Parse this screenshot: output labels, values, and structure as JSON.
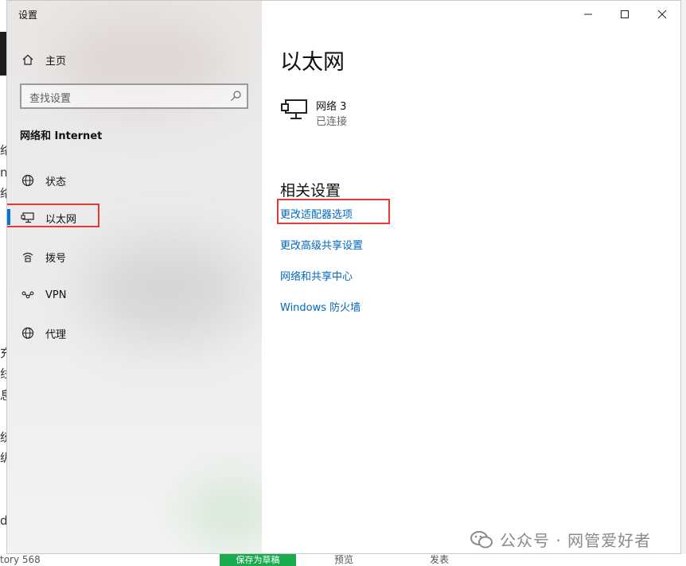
{
  "window": {
    "title": "设置"
  },
  "nav": {
    "home_label": "主页",
    "search_placeholder": "查找设置",
    "section_label": "网络和 Internet",
    "items": [
      {
        "label": "状态",
        "icon": "globe-status-icon"
      },
      {
        "label": "以太网",
        "icon": "ethernet-icon",
        "selected": true
      },
      {
        "label": "拨号",
        "icon": "dialup-icon"
      },
      {
        "label": "VPN",
        "icon": "vpn-icon"
      },
      {
        "label": "代理",
        "icon": "globe-proxy-icon"
      }
    ]
  },
  "content": {
    "page_title": "以太网",
    "network": {
      "name": "网络 3",
      "status": "已连接"
    },
    "related_title": "相关设置",
    "links": [
      "更改适配器选项",
      "更改高级共享设置",
      "网络和共享中心",
      "Windows 防火墙"
    ]
  },
  "watermark": "公众号 · 网管爱好者",
  "background": {
    "left_glyphs": [
      "络",
      "n",
      "络",
      "充",
      "线",
      "息",
      "统",
      "纵",
      "d"
    ],
    "bottom_texts": [
      "tory 568",
      "保存为草稿",
      "预览",
      "发表"
    ]
  },
  "colors": {
    "accent": "#0078d7",
    "link": "#0067c0",
    "highlight_box": "#e53935"
  }
}
